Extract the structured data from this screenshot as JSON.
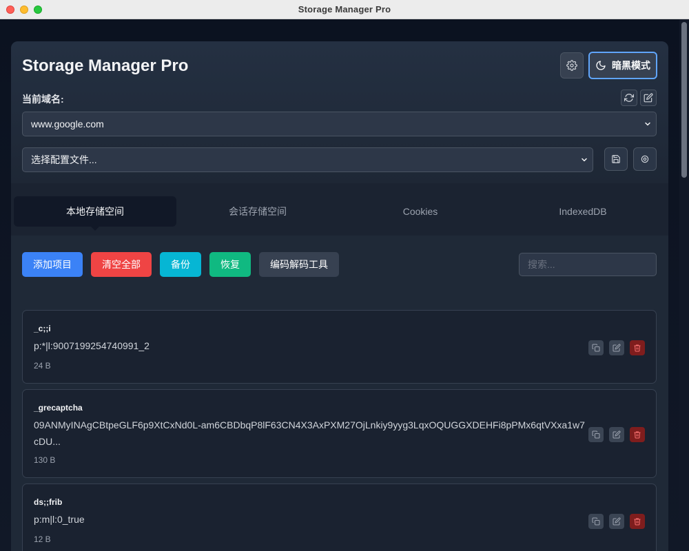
{
  "window": {
    "title": "Storage Manager Pro"
  },
  "header": {
    "app_title": "Storage Manager Pro",
    "settings_icon": "gear-icon",
    "dark_mode_label": "暗黑模式",
    "dark_mode_icon": "moon-icon",
    "domain_label": "当前域名:",
    "domain_value": "www.google.com",
    "profile_value": "选择配置文件..."
  },
  "tabs": [
    {
      "label": "本地存储空间",
      "active": true
    },
    {
      "label": "会话存储空间",
      "active": false
    },
    {
      "label": "Cookies",
      "active": false
    },
    {
      "label": "IndexedDB",
      "active": false
    }
  ],
  "toolbar": {
    "add_label": "添加项目",
    "clear_label": "清空全部",
    "backup_label": "备份",
    "restore_label": "恢复",
    "codec_label": "编码解码工具",
    "search_placeholder": "搜索..."
  },
  "items": [
    {
      "key": "_c;;i",
      "value": "p:*|l:9007199254740991_2",
      "size": "24 B"
    },
    {
      "key": "_grecaptcha",
      "value": "09ANMyINAgCBtpeGLF6p9XtCxNd0L-am6CBDbqP8lF63CN4X3AxPXM27OjLnkiy9yyg3LqxOQUGGXDEHFi8pPMx6qtVXxa1w7cDU...",
      "size": "130 B"
    },
    {
      "key": "ds;;frib",
      "value": "p:m|l:0_true",
      "size": "12 B"
    }
  ],
  "colors": {
    "add": "#3b82f6",
    "clear": "#ef4444",
    "backup": "#06b6d4",
    "restore": "#10b981",
    "codec": "#374151",
    "focus": "#60a5fa"
  }
}
